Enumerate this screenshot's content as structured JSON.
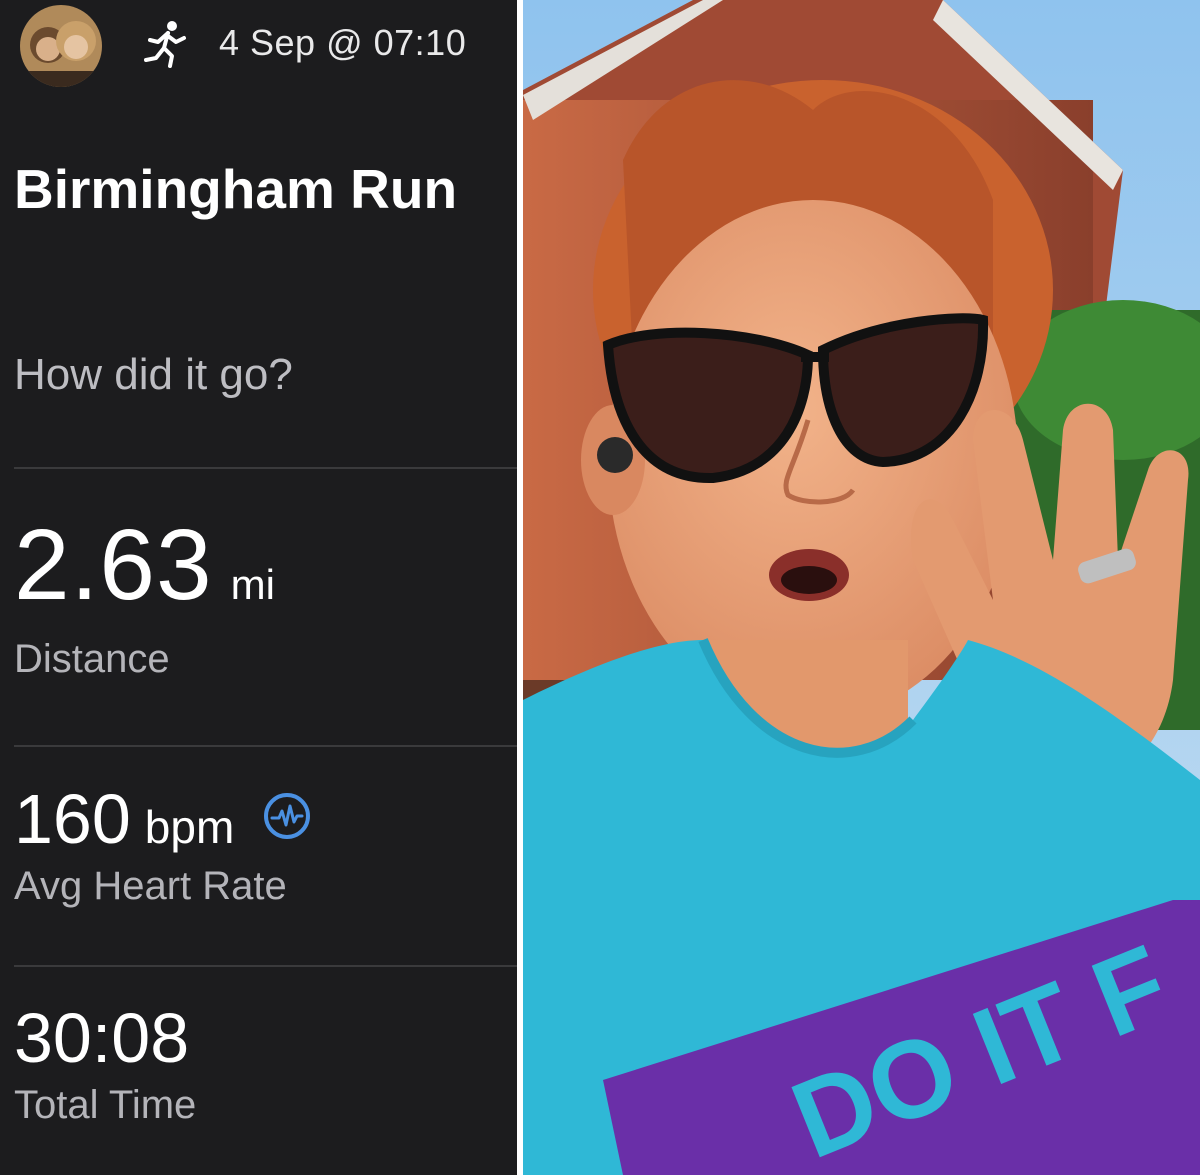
{
  "activity": {
    "icon": "running-person-icon",
    "datetime": "4 Sep @ 07:10",
    "title": "Birmingham Run",
    "prompt": "How did it go?"
  },
  "stats": {
    "distance": {
      "value": "2.63",
      "unit": "mi",
      "label": "Distance"
    },
    "heart_rate": {
      "value": "160",
      "unit": "bpm",
      "label": "Avg Heart Rate",
      "icon": "heart-rate-monitor-icon"
    },
    "total_time": {
      "value": "30:08",
      "label": "Total Time"
    }
  },
  "colors": {
    "app_background": "#1c1c1e",
    "accent_blue": "#4a90e2",
    "shirt_blue": "#2fb8d6",
    "shirt_purple": "#6a2fa8"
  },
  "photo": {
    "shirt_text": "DO IT F"
  }
}
